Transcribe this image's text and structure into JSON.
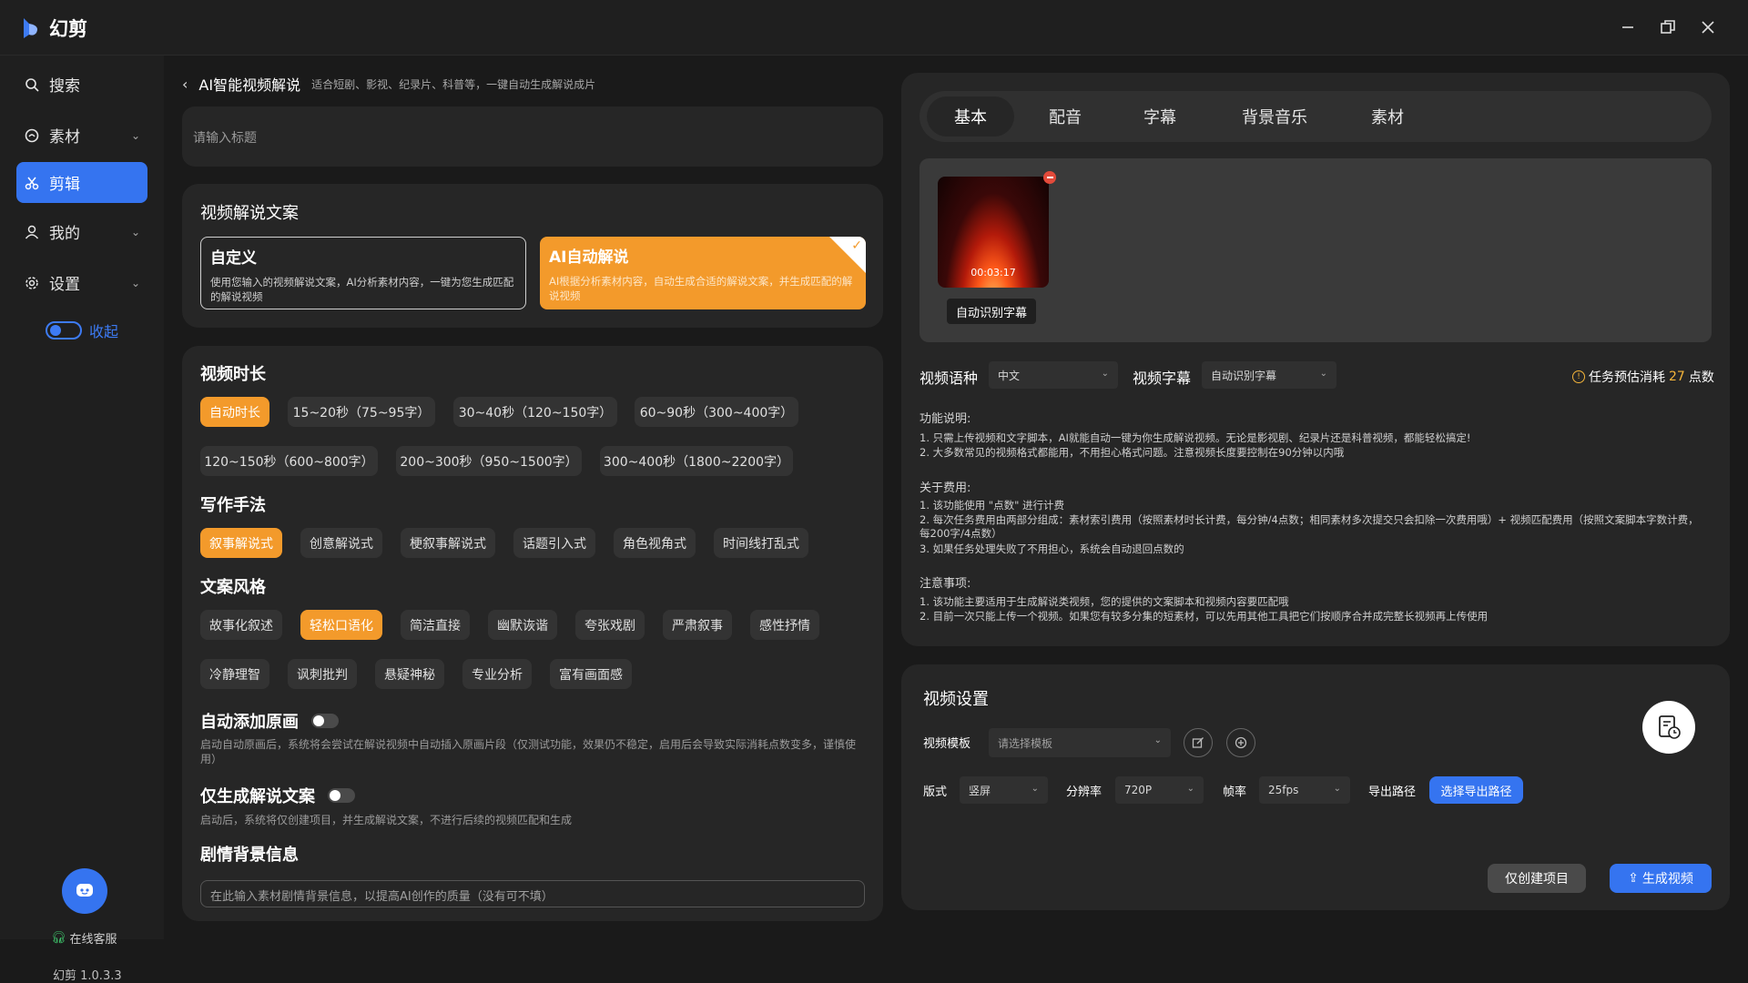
{
  "app": {
    "name": "幻剪",
    "version": "幻剪 1.0.3.3"
  },
  "sidebar": {
    "items": [
      {
        "label": "搜索",
        "icon": "search-icon"
      },
      {
        "label": "素材",
        "icon": "material-icon"
      },
      {
        "label": "剪辑",
        "icon": "scissors-icon"
      },
      {
        "label": "我的",
        "icon": "user-icon"
      },
      {
        "label": "设置",
        "icon": "gear-icon"
      }
    ],
    "collapse_label": "收起",
    "customer_service": "在线客服"
  },
  "page": {
    "title": "AI智能视频解说",
    "subtitle": "适合短剧、影视、纪录片、科普等，一键自动生成解说成片",
    "title_placeholder": "请输入标题"
  },
  "script_section": {
    "title": "视频解说文案",
    "custom": {
      "title": "自定义",
      "desc": "使用您输入的视频解说文案，AI分析素材内容，一键为您生成匹配的解说视频"
    },
    "ai": {
      "title": "AI自动解说",
      "desc": "AI根据分析素材内容，自动生成合适的解说文案，并生成匹配的解说视频"
    }
  },
  "duration": {
    "title": "视频时长",
    "options": [
      "自动时长",
      "15~20秒（75~95字）",
      "30~40秒（120~150字）",
      "60~90秒（300~400字）",
      "120~150秒（600~800字）",
      "200~300秒（950~1500字）",
      "300~400秒（1800~2200字）"
    ]
  },
  "writing": {
    "title": "写作手法",
    "options": [
      "叙事解说式",
      "创意解说式",
      "梗叙事解说式",
      "话题引入式",
      "角色视角式",
      "时间线打乱式"
    ]
  },
  "style": {
    "title": "文案风格",
    "options": [
      "故事化叙述",
      "轻松口语化",
      "简洁直接",
      "幽默诙谐",
      "夸张戏剧",
      "严肃叙事",
      "感性抒情",
      "冷静理智",
      "讽刺批判",
      "悬疑神秘",
      "专业分析",
      "富有画面感"
    ]
  },
  "auto_original": {
    "title": "自动添加原画",
    "hint": "启动自动原画后，系统将会尝试在解说视频中自动插入原画片段（仅测试功能，效果仍不稳定，启用后会导致实际消耗点数变多，谨慎使用）"
  },
  "only_script": {
    "title": "仅生成解说文案",
    "hint": "启动后，系统将仅创建项目，并生成解说文案，不进行后续的视频匹配和生成"
  },
  "plot_bg": {
    "title": "剧情背景信息",
    "placeholder": "在此输入素材剧情背景信息，以提高AI创作的质量（没有可不填）"
  },
  "right_tabs": [
    "基本",
    "配音",
    "字幕",
    "背景音乐",
    "素材"
  ],
  "media": {
    "duration": "00:03:17",
    "button": "自动识别字幕"
  },
  "lang_row": {
    "lang_label": "视频语种",
    "lang_value": "中文",
    "sub_label": "视频字幕",
    "sub_value": "自动识别字幕",
    "cost_prefix": "任务预估消耗",
    "cost_value": "27",
    "cost_unit": "点数"
  },
  "info": {
    "feature_title": "功能说明:",
    "feature_lines": [
      "1. 只需上传视频和文字脚本，AI就能自动一键为你生成解说视频。无论是影视剧、纪录片还是科普视频，都能轻松搞定!",
      "2. 大多数常见的视频格式都能用，不用担心格式问题。注意视频长度要控制在90分钟以内哦"
    ],
    "fee_title": "关于费用:",
    "fee_lines": [
      "1. 该功能使用 \"点数\" 进行计费",
      "2. 每次任务费用由两部分组成：素材索引费用（按照素材时长计费，每分钟/4点数；相同素材多次提交只会扣除一次费用哦）+ 视频匹配费用（按照文案脚本字数计费，每200字/4点数）",
      "3. 如果任务处理失败了不用担心，系统会自动退回点数的"
    ],
    "note_title": "注意事项:",
    "note_lines": [
      "1. 该功能主要适用于生成解说类视频，您的提供的文案脚本和视频内容要匹配哦",
      "2. 目前一次只能上传一个视频。如果您有较多分集的短素材，可以先用其他工具把它们按顺序合并成完整长视频再上传使用"
    ]
  },
  "video_settings": {
    "title": "视频设置",
    "template_label": "视频模板",
    "template_placeholder": "请选择模板",
    "layout_label": "版式",
    "layout_value": "竖屏",
    "resolution_label": "分辨率",
    "resolution_value": "720P",
    "fps_label": "帧率",
    "fps_value": "25fps",
    "export_label": "导出路径",
    "export_button": "选择导出路径"
  },
  "actions": {
    "create_only": "仅创建项目",
    "generate": "生成视频"
  },
  "colors": {
    "accent_blue": "#3574f0",
    "accent_orange": "#f39a2b",
    "bg": "#1a1a1a",
    "card": "#262626"
  }
}
